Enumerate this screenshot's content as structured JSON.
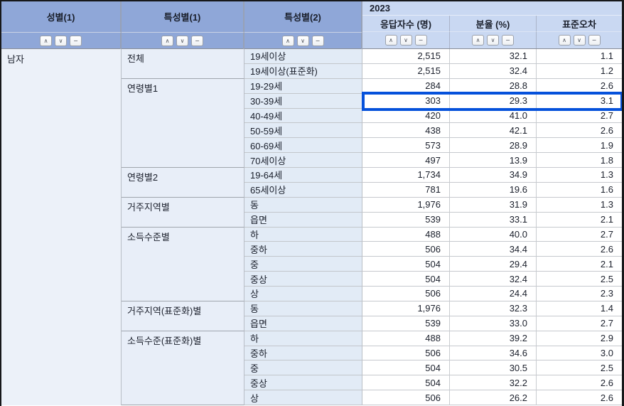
{
  "table": {
    "columns": {
      "stub": [
        "성별(1)",
        "특성별(1)",
        "특성별(2)"
      ],
      "year": "2023",
      "metrics": [
        "응답자수 (명)",
        "분율 (%)",
        "표준오차"
      ]
    },
    "sort_icons": {
      "up": "∧",
      "down": "∨",
      "collapse": "−"
    },
    "gender": "남자",
    "groups": [
      {
        "label": "전체",
        "rows": [
          {
            "label": "19세이상",
            "values": [
              "2,515",
              "32.1",
              "1.1"
            ]
          },
          {
            "label": "19세이상(표준화)",
            "values": [
              "2,515",
              "32.4",
              "1.2"
            ]
          }
        ]
      },
      {
        "label": "연령별1",
        "rows": [
          {
            "label": "19-29세",
            "values": [
              "284",
              "28.8",
              "2.6"
            ]
          },
          {
            "label": "30-39세",
            "values": [
              "303",
              "29.3",
              "3.1"
            ],
            "selected": true
          },
          {
            "label": "40-49세",
            "values": [
              "420",
              "41.0",
              "2.7"
            ]
          },
          {
            "label": "50-59세",
            "values": [
              "438",
              "42.1",
              "2.6"
            ]
          },
          {
            "label": "60-69세",
            "values": [
              "573",
              "28.9",
              "1.9"
            ]
          },
          {
            "label": "70세이상",
            "values": [
              "497",
              "13.9",
              "1.8"
            ]
          }
        ]
      },
      {
        "label": "연령별2",
        "rows": [
          {
            "label": "19-64세",
            "values": [
              "1,734",
              "34.9",
              "1.3"
            ]
          },
          {
            "label": "65세이상",
            "values": [
              "781",
              "19.6",
              "1.6"
            ]
          }
        ]
      },
      {
        "label": "거주지역별",
        "rows": [
          {
            "label": "동",
            "values": [
              "1,976",
              "31.9",
              "1.3"
            ]
          },
          {
            "label": "읍면",
            "values": [
              "539",
              "33.1",
              "2.1"
            ]
          }
        ]
      },
      {
        "label": "소득수준별",
        "rows": [
          {
            "label": "하",
            "values": [
              "488",
              "40.0",
              "2.7"
            ]
          },
          {
            "label": "중하",
            "values": [
              "506",
              "34.4",
              "2.6"
            ]
          },
          {
            "label": "중",
            "values": [
              "504",
              "29.4",
              "2.1"
            ]
          },
          {
            "label": "중상",
            "values": [
              "504",
              "32.4",
              "2.5"
            ]
          },
          {
            "label": "상",
            "values": [
              "506",
              "24.4",
              "2.3"
            ]
          }
        ]
      },
      {
        "label": "거주지역(표준화)별",
        "rows": [
          {
            "label": "동",
            "values": [
              "1,976",
              "32.3",
              "1.4"
            ]
          },
          {
            "label": "읍면",
            "values": [
              "539",
              "33.0",
              "2.7"
            ]
          }
        ]
      },
      {
        "label": "소득수준(표준화)별",
        "rows": [
          {
            "label": "하",
            "values": [
              "488",
              "39.2",
              "2.9"
            ]
          },
          {
            "label": "중하",
            "values": [
              "506",
              "34.6",
              "3.0"
            ]
          },
          {
            "label": "중",
            "values": [
              "504",
              "30.5",
              "2.5"
            ]
          },
          {
            "label": "중상",
            "values": [
              "504",
              "32.2",
              "2.6"
            ]
          },
          {
            "label": "상",
            "values": [
              "506",
              "26.2",
              "2.6"
            ]
          }
        ]
      }
    ],
    "colors": {
      "selection_border": "#0551DB",
      "header_stub_bg": "#8FA7D8",
      "header_year_bg": "#C9D8F2"
    }
  }
}
